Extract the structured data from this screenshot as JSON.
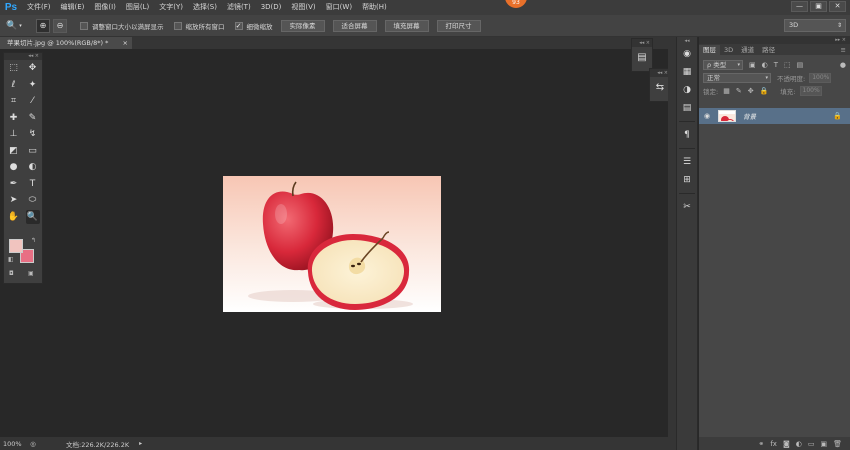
{
  "app": {
    "logo": "Ps",
    "badge": "93"
  },
  "menu": [
    "文件(F)",
    "编辑(E)",
    "图像(I)",
    "图层(L)",
    "文字(Y)",
    "选择(S)",
    "滤镜(T)",
    "3D(D)",
    "视图(V)",
    "窗口(W)",
    "帮助(H)"
  ],
  "window_buttons": [
    "—",
    "▣",
    "✕"
  ],
  "options": {
    "check_resize_windows": "调整窗口大小以满屏显示",
    "check_zoom_all": "缩放所有窗口",
    "check_scrubby": "细微缩放",
    "btn_actual_pixels": "实际像素",
    "btn_fit_screen": "适合屏幕",
    "btn_fill_screen": "填充屏幕",
    "btn_print_size": "打印尺寸",
    "workspace": "3D"
  },
  "document": {
    "tab_title": "苹果切片.jpg @ 100%(RGB/8*) *",
    "tab_close": "×"
  },
  "layers_panel": {
    "tabs": [
      "图层",
      "3D",
      "通道",
      "路径"
    ],
    "filter_label": "ρ 类型",
    "blend_mode": "正常",
    "opacity_label": "不透明度:",
    "opacity_value": "100%",
    "lock_label": "锁定:",
    "fill_label": "填充:",
    "fill_value": "100%",
    "layer_name": "背景"
  },
  "status": {
    "zoom": "100%",
    "doc_info": "文档:226.2K/226.2K"
  },
  "colors": {
    "foreground": "#f1c4bf",
    "background": "#e86f84",
    "selected_layer": "#587089"
  }
}
